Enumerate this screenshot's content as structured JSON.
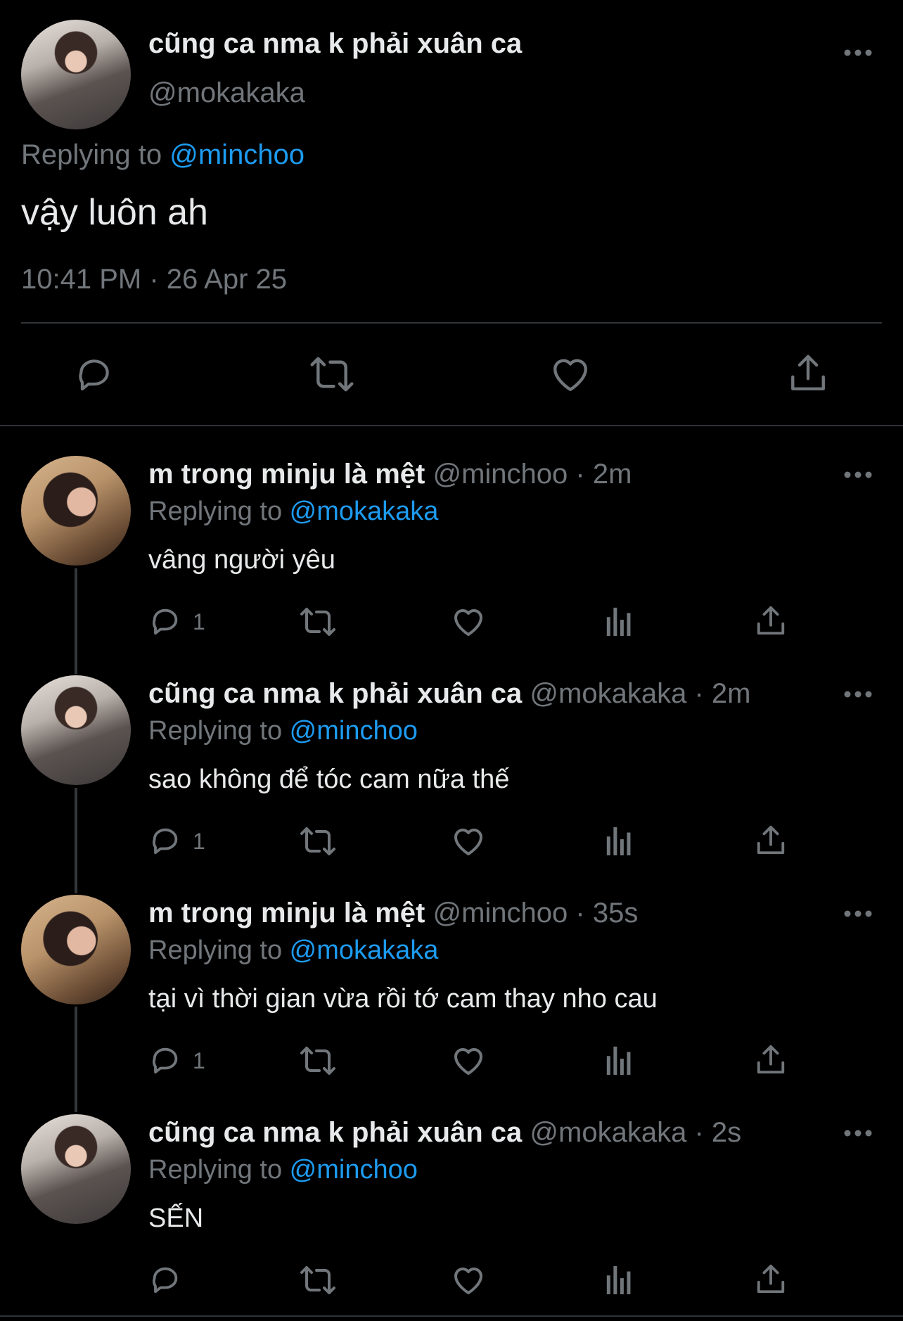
{
  "main": {
    "author": "cũng ca nma k phải xuân ca",
    "handle": "@mokakaka",
    "replying_prefix": "Replying to",
    "replying_to": "@minchoo",
    "text": "vậy luôn ah",
    "timestamp": "10:41 PM · 26 Apr 25"
  },
  "replies": [
    {
      "author": "m trong minju là mệt",
      "handle_time": "@minchoo · 2m",
      "replying_to": "@mokakaka",
      "text": "vâng người yêu",
      "reply_count": "1"
    },
    {
      "author": "cũng ca nma k phải xuân ca",
      "handle_time": "@mokakaka · 2m",
      "replying_to": "@minchoo",
      "text": "sao không để tóc cam nữa thế",
      "reply_count": "1"
    },
    {
      "author": "m trong minju là mệt",
      "handle_time": "@minchoo · 35s",
      "replying_to": "@mokakaka",
      "text": "tại vì thời gian vừa rồi tớ cam thay nho cau",
      "reply_count": "1"
    },
    {
      "author": "cũng ca nma k phải xuân ca",
      "handle_time": "@mokakaka · 2s",
      "replying_to": "@minchoo",
      "text": "SẾN",
      "reply_count": ""
    }
  ],
  "colors": {
    "background": "#000000",
    "text": "#e7e9ea",
    "muted": "#71767b",
    "accent": "#1d9bf0",
    "divider": "#2f3336"
  },
  "icons": {
    "reply": "reply-icon",
    "retweet": "retweet-icon",
    "like": "heart-icon",
    "views": "views-icon",
    "share": "share-icon",
    "more": "more-icon"
  }
}
